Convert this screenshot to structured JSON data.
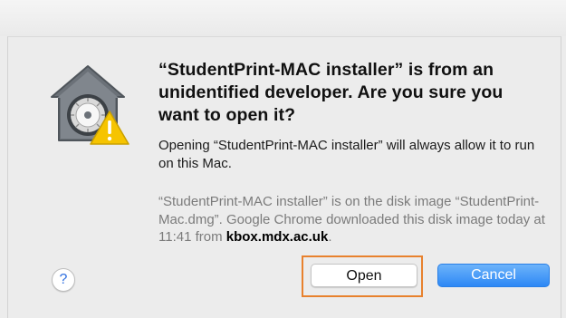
{
  "dialog": {
    "headline": "“StudentPrint-MAC installer” is from an unidentified developer. Are you sure you want to open it?",
    "info": "Opening “StudentPrint-MAC installer” will always allow it to run on this Mac.",
    "source_prefix": "“StudentPrint-MAC installer” is on the disk image “StudentPrint-Mac.dmg”. Google Chrome downloaded this disk image today at 11:41 from",
    "source_domain": "kbox.mdx.ac.uk",
    "source_suffix": ".",
    "help_label": "?",
    "open_label": "Open",
    "cancel_label": "Cancel",
    "icon": "gatekeeper-warning-icon"
  },
  "colors": {
    "highlight": "#e8812d",
    "primary_button": "#2d88f5",
    "warning": "#f6c400"
  }
}
